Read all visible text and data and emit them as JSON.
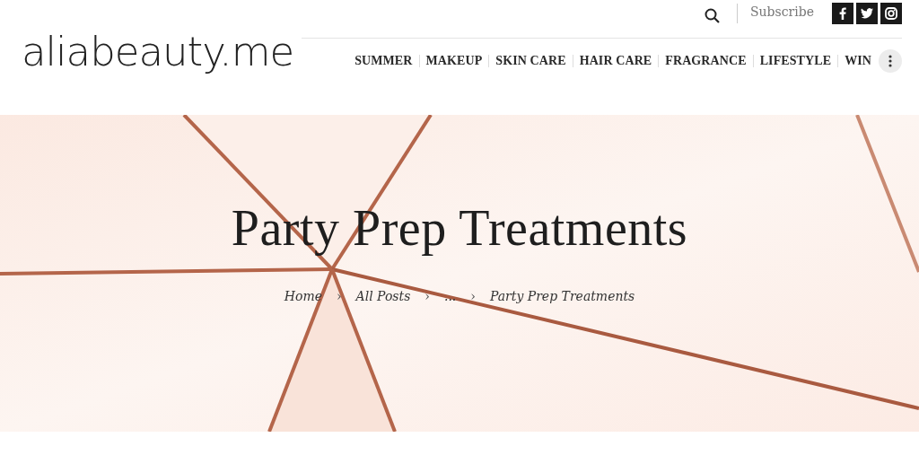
{
  "logo": "aliabeauty.me",
  "top_bar": {
    "subscribe": "Subscribe",
    "social": [
      {
        "kind": "facebook"
      },
      {
        "kind": "twitter"
      },
      {
        "kind": "instagram"
      }
    ]
  },
  "nav": {
    "items": [
      "SUMMER",
      "MAKEUP",
      "SKIN CARE",
      "HAIR CARE",
      "FRAGRANCE",
      "LIFESTYLE",
      "WIN"
    ]
  },
  "hero": {
    "kind": "picture",
    "title": "Party Prep Treatments",
    "breadcrumb": [
      {
        "kind": "link",
        "text": "Home"
      },
      {
        "kind": "sep",
        "text": "›"
      },
      {
        "kind": "link",
        "text": "All Posts"
      },
      {
        "kind": "sep",
        "text": "›"
      },
      {
        "kind": "link",
        "text": "..."
      },
      {
        "kind": "sep",
        "text": "›"
      },
      {
        "kind": "current",
        "text": "Party Prep Treatments"
      }
    ]
  }
}
